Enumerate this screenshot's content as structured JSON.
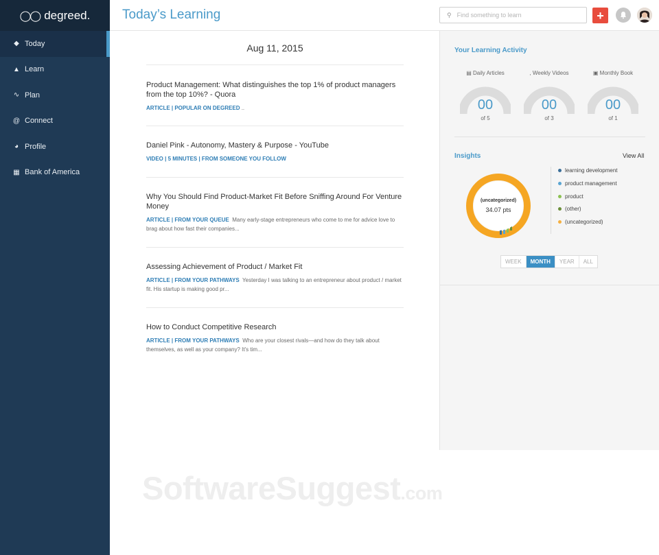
{
  "sidebar": {
    "logo_text": "degreed.",
    "items": [
      {
        "label": "Today",
        "icon": "diamond-icon"
      },
      {
        "label": "Learn",
        "icon": "bank-icon"
      },
      {
        "label": "Plan",
        "icon": "trend-icon"
      },
      {
        "label": "Connect",
        "icon": "at-icon"
      },
      {
        "label": "Profile",
        "icon": "pie-icon"
      },
      {
        "label": "Bank of America",
        "icon": "building-icon"
      }
    ]
  },
  "header": {
    "title": "Today’s Learning",
    "search_placeholder": "Find something to learn"
  },
  "feed": {
    "date": "Aug 11, 2015",
    "items": [
      {
        "title": "Product Management: What distinguishes the top 1% of product managers from the top 10%? - Quora",
        "tags": "ARTICLE | POPULAR ON DEGREED",
        "summary": " .."
      },
      {
        "title": "Daniel Pink - Autonomy, Mastery & Purpose - YouTube",
        "tags": "VIDEO | 5 MINUTES | FROM SOMEONE YOU FOLLOW",
        "summary": ""
      },
      {
        "title": "Why You Should Find Product-Market Fit Before Sniffing Around For Venture Money",
        "tags": "ARTICLE | FROM YOUR QUEUE",
        "summary": "Many early-stage entrepreneurs who come to me for advice love to brag about how fast their companies..."
      },
      {
        "title": "Assessing Achievement of Product / Market Fit",
        "tags": "ARTICLE | FROM YOUR PATHWAYS",
        "summary": "Yesterday I was talking to an entrepreneur about product / market fit. His startup is making good pr..."
      },
      {
        "title": "How to Conduct Competitive Research",
        "tags": "ARTICLE | FROM YOUR PATHWAYS",
        "summary": "Who are your closest rivals—and how do they talk about themselves, as well as your company? It's tim..."
      }
    ]
  },
  "activity": {
    "title": "Your Learning Activity",
    "gauges": [
      {
        "label": "Daily Articles",
        "value": "00",
        "of": "of 5"
      },
      {
        "label": ", Weekly Videos",
        "value": "00",
        "of": "of 3"
      },
      {
        "label": "Monthly Book",
        "value": "00",
        "of": "of 1"
      }
    ]
  },
  "insights": {
    "title": "Insights",
    "view_all": "View All",
    "donut_label": "(uncategorized)",
    "donut_points": "34.07 pts",
    "legend": [
      {
        "label": "learning development",
        "color": "#3b6f99"
      },
      {
        "label": "product management",
        "color": "#5aa5d2"
      },
      {
        "label": "product",
        "color": "#8cc152"
      },
      {
        "label": "(other)",
        "color": "#6b8f3a"
      },
      {
        "label": "(uncategorized)",
        "color": "#f5b041"
      }
    ],
    "periods": [
      "WEEK",
      "MONTH",
      "YEAR",
      "ALL"
    ],
    "active_period": "MONTH"
  },
  "watermark": {
    "main": "SoftwareSuggest",
    "suffix": ".com"
  }
}
